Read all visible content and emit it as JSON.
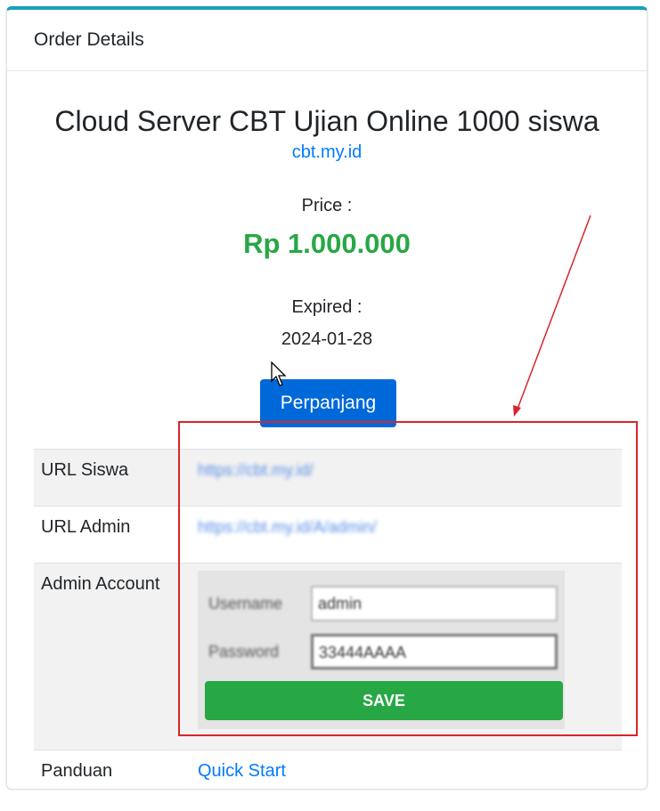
{
  "card": {
    "header_title": "Order Details"
  },
  "product": {
    "name": "Cloud Server CBT Ujian Online 1000 siswa",
    "domain": "cbt.my.id"
  },
  "price": {
    "label": "Price :",
    "value": "Rp 1.000.000"
  },
  "expiry": {
    "label": "Expired :",
    "value": "2024-01-28"
  },
  "renew_button": "Perpanjang",
  "details": {
    "url_siswa": {
      "label": "URL Siswa",
      "value": "https://cbt.my.id/"
    },
    "url_admin": {
      "label": "URL Admin",
      "value": "https://cbt.my.id/A/admin/"
    },
    "admin_account": {
      "label": "Admin Account",
      "username_label": "Username",
      "username_value": "admin",
      "password_label": "Password",
      "password_value": "33444AAAA",
      "save_label": "SAVE"
    },
    "panduan": {
      "label": "Panduan",
      "value": "Quick Start"
    }
  },
  "colors": {
    "accent_top": "#17a2b8",
    "price": "#28a745",
    "primary_button": "#0069d9",
    "save_button": "#28a745",
    "annotation": "#d9252a"
  }
}
